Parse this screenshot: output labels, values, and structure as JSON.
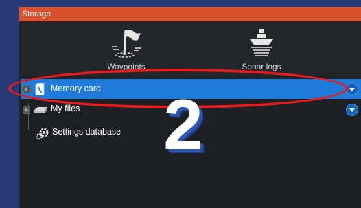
{
  "dialog": {
    "title": "Storage"
  },
  "toolbar": {
    "items": [
      {
        "label": "Waypoints",
        "icon": "flag-icon"
      },
      {
        "label": "Sonar logs",
        "icon": "boat-sonar-icon"
      }
    ]
  },
  "tree": {
    "items": [
      {
        "label": "Memory card",
        "icon": "memory-card-icon",
        "selected": true,
        "has_dropdown": true
      },
      {
        "label": "My files",
        "icon": "drive-icon",
        "selected": false,
        "has_dropdown": true
      },
      {
        "label": "Settings database",
        "icon": "settings-gear-icon",
        "selected": false,
        "has_dropdown": false
      }
    ]
  },
  "annotation": {
    "step": "2",
    "ring_color": "#e81c1c"
  },
  "colors": {
    "titlebar": "#d8512f",
    "selection": "#1f7bd9",
    "panel": "#23272c"
  }
}
